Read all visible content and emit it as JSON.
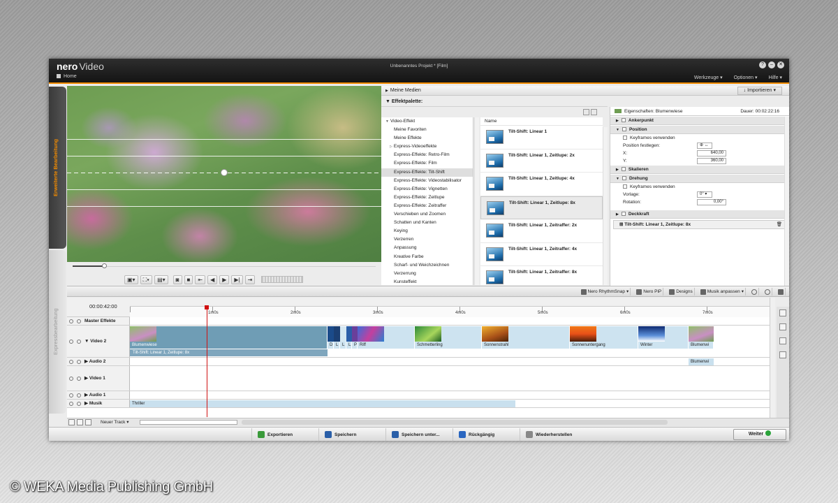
{
  "app": {
    "logo": "nero",
    "product": "Video",
    "home_label": "Home",
    "window_title": "Unbenanntes Projekt * [Film]",
    "menu": [
      "Werkzeuge",
      "Optionen",
      "Hilfe"
    ],
    "accent_color": "#f08a00"
  },
  "side_tabs": {
    "advanced": "Erweiterte Bearbeitung",
    "express": "Expressbearbeitung"
  },
  "media": {
    "my_media": "Meine Medien",
    "import_label": "Importieren",
    "effects_palette": "Effektpalette:"
  },
  "tree": {
    "root": "Video-Effekt",
    "items": [
      "Meine Favoriten",
      "Meine Effekte",
      "Express-Videoeffekte",
      "Express-Effekte: Retro-Film",
      "Express-Effekte: Film",
      "Express-Effekte: Tilt-Shift",
      "Express-Effekte: Videostabilisator",
      "Express-Effekte: Vignetten",
      "Express-Effekte: Zeitlupe",
      "Express-Effekte: Zeitraffer",
      "Verschieben und Zoomen",
      "Schatten und Kanten",
      "Keying",
      "Verzerren",
      "Anpassung",
      "Kreative Farbe",
      "Scharf- und Weichzeichnen",
      "Verzerrung",
      "Kunsteffekt"
    ],
    "selected_index": 5
  },
  "effects": {
    "column_header": "Name",
    "items": [
      "Tilt-Shift: Linear 1",
      "Tilt-Shift: Linear 1, Zeitlupe: 2x",
      "Tilt-Shift: Linear 1, Zeitlupe: 4x",
      "Tilt-Shift: Linear 1, Zeitlupe: 8x",
      "Tilt-Shift: Linear 1, Zeitraffer: 2x",
      "Tilt-Shift: Linear 1, Zeitraffer: 4x",
      "Tilt-Shift: Linear 1, Zeitraffer: 8x"
    ],
    "selected_index": 3
  },
  "properties": {
    "title": "Eigenschaften: Blumenwiese",
    "duration_label": "Dauer:",
    "duration": "00:02:22:16",
    "sections": {
      "ankerpunkt": "Ankerpunkt",
      "position": "Position",
      "skalieren": "Skalieren",
      "drehung": "Drehung",
      "deckkraft": "Deckkraft"
    },
    "keyframes_label": "Keyframes verwenden",
    "position_set_label": "Position festlegen:",
    "x_label": "X:",
    "x_value": "640,00",
    "y_label": "Y:",
    "y_value": "360,00",
    "vorlage_label": "Vorlage:",
    "vorlage_value": "0°",
    "rotation_label": "Rotation:",
    "rotation_value": "0,00°",
    "applied_effect": "Tilt-Shift: Linear 1, Zeitlupe: 8x"
  },
  "toolstrip": {
    "rhythm_snap": "Nero RhythmSnap",
    "pip": "Nero PiP",
    "designs": "Designs",
    "fit_music": "Musik anpassen"
  },
  "timeline": {
    "timecode": "00:00:42:00",
    "ruler": [
      "1m0s",
      "2m0s",
      "3m0s",
      "4m0s",
      "5m0s",
      "6m0s",
      "7m0s"
    ],
    "tracks": {
      "master": "Master Effekte",
      "video2": "Video 2",
      "audio2": "Audio 2",
      "video1": "Video 1",
      "audio1": "Audio 1",
      "musik": "Musik"
    },
    "clips": [
      "Blumenwiese",
      "D",
      "L",
      "L",
      "L",
      "P",
      "Riff",
      "Schmetterling",
      "Sonnenstrahl",
      "Sonnenuntergang",
      "Winter",
      "Blumenwi"
    ],
    "fx_bar": "Tilt-Shift: Linear 1, Zeitlupe: 8x",
    "audio2_clip": "Blumenwi",
    "music_clip": "Thriller",
    "new_track": "Neuer Track"
  },
  "actions": {
    "export": "Exportieren",
    "save": "Speichern",
    "save_as": "Speichern unter...",
    "undo": "Rückgängig",
    "redo": "Wiederherstellen",
    "next": "Weiter"
  },
  "copyright": "© WEKA Media Publishing GmbH"
}
